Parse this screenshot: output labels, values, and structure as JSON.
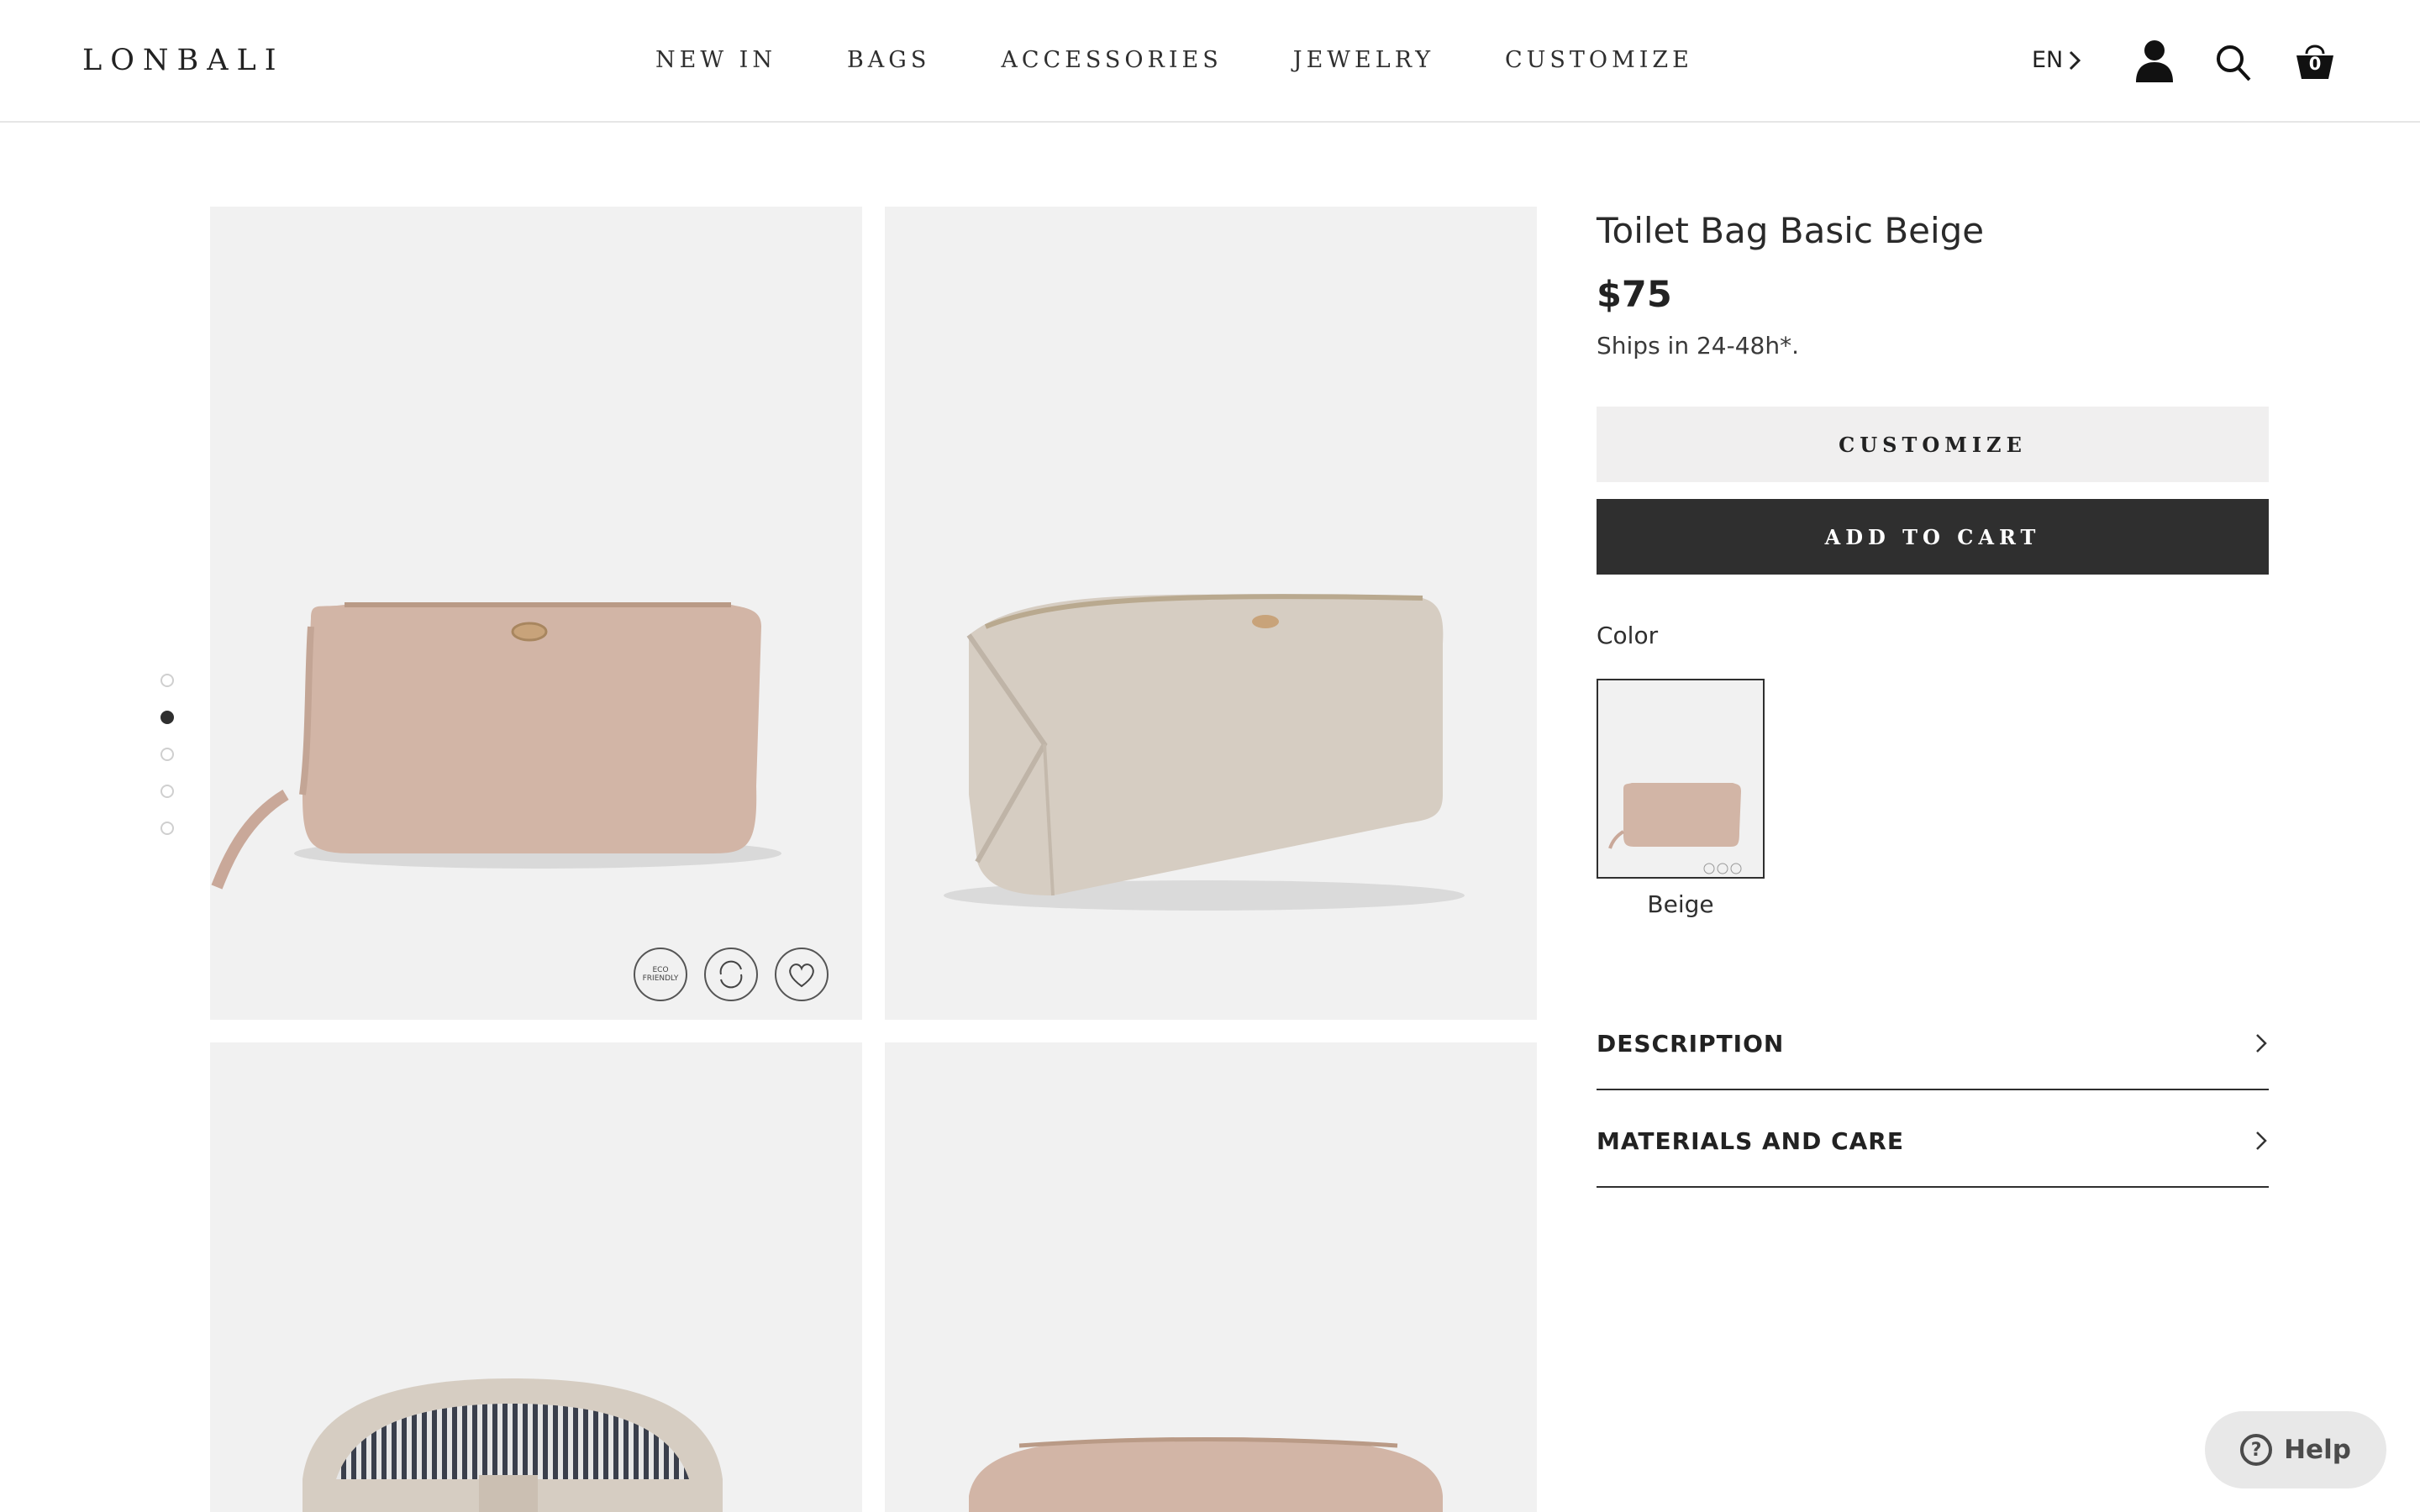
{
  "header": {
    "logo": "LONBALI",
    "nav": [
      "NEW IN",
      "BAGS",
      "ACCESSORIES",
      "JEWELRY",
      "CUSTOMIZE"
    ],
    "language": "EN",
    "cart_count": "0"
  },
  "gallery": {
    "badges": [
      "ECO FRIENDLY",
      "",
      ""
    ]
  },
  "product": {
    "title": "Toilet Bag Basic Beige",
    "price": "$75",
    "shipping": "Ships in 24-48h*.",
    "customize_label": "CUSTOMIZE",
    "add_to_cart_label": "ADD TO CART",
    "color_label": "Color",
    "color_name": "Beige",
    "accordions": [
      "DESCRIPTION",
      "MATERIALS AND CARE"
    ]
  },
  "help": {
    "label": "Help",
    "icon": "?"
  },
  "colors": {
    "dark": "#2f2f2f",
    "panel": "#f1f1f1",
    "bag_beige": "#d2b5a6",
    "bag_taupe": "#d6cdc2"
  }
}
